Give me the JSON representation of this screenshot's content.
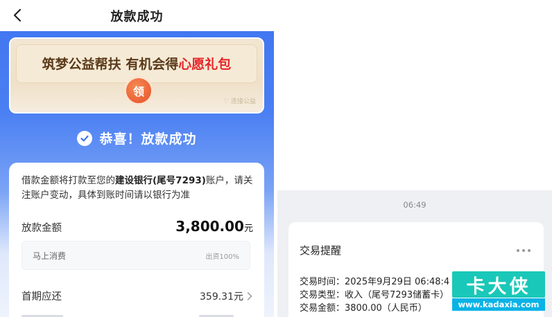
{
  "left": {
    "nav_title": "放款成功",
    "banner": {
      "text_main": "筑梦公益帮扶 有机会得",
      "text_highlight": "心愿礼包",
      "button_label": "领",
      "mark": "♡ 连接公益"
    },
    "success_text": "恭喜！放款成功",
    "card": {
      "notice_prefix": "借款金额将打款至您的",
      "notice_bank": "建设银行(尾号7293)",
      "notice_suffix": "账户，请关注账户变动，具体到账时间请以银行为准",
      "amount_label": "放款金额",
      "amount_value": "3,800.00",
      "amount_unit": "元",
      "lender_name": "马上消费",
      "lender_ratio": "出资100%",
      "first_label": "首期应还",
      "first_value": "359.31元"
    }
  },
  "right": {
    "time": "06:49",
    "sms_title": "交易提醒",
    "lines": [
      "交易时间：2025年9月29日 06:48:4",
      "交易类型：收入（尾号7293储蓄卡）",
      "交易金额：3800.00（人民币）"
    ]
  },
  "watermark": {
    "name": "卡大侠",
    "url": "www.kadaxia.com"
  },
  "colors": {
    "primary_blue": "#3f74f0",
    "highlight_red": "#e6262a",
    "watermark_teal": "#19c8b8"
  }
}
